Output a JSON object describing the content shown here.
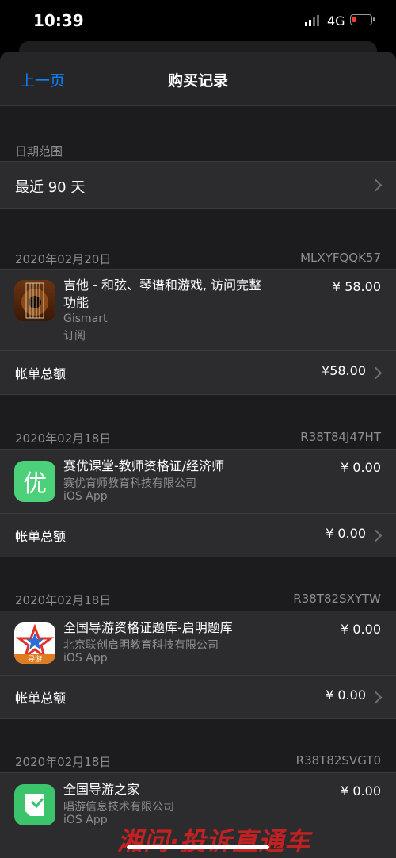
{
  "status": {
    "time": "10:39",
    "network": "4G"
  },
  "nav": {
    "back_label": "上一页",
    "title": "购买记录"
  },
  "date_range": {
    "section_label": "日期范围",
    "value": "最近 90 天"
  },
  "orders": [
    {
      "date": "2020年02月20日",
      "order_id": "MLXYFQQK57",
      "item": {
        "name": "吉他 - 和弦、琴谱和游戏, 访问完整功能",
        "developer": "Gismart",
        "type": "订阅",
        "price": "¥ 58.00",
        "icon": "guitar-app-icon"
      },
      "total_label": "帐单总额",
      "total": "¥58.00"
    },
    {
      "date": "2020年02月18日",
      "order_id": "R38T84J47HT",
      "item": {
        "name": "赛优课堂-教师资格证/经济师",
        "developer": "赛优育师教育科技有限公司",
        "type": "iOS App",
        "price": "¥ 0.00",
        "icon": "saiyou-app-icon",
        "icon_text": "优"
      },
      "total_label": "帐单总额",
      "total": "¥ 0.00"
    },
    {
      "date": "2020年02月18日",
      "order_id": "R38T82SXYTW",
      "item": {
        "name": "全国导游资格证题库-启明题库",
        "developer": "北京联创启明教育科技有限公司",
        "type": "iOS App",
        "price": "¥ 0.00",
        "icon": "daoyou-app-icon",
        "icon_text": "导游"
      },
      "total_label": "帐单总额",
      "total": "¥ 0.00"
    },
    {
      "date": "2020年02月18日",
      "order_id": "R38T82SVGT0",
      "item": {
        "name": "全国导游之家",
        "developer": "唱游信息技术有限公司",
        "type": "iOS App",
        "price": "¥ 0.00",
        "icon": "daoyou-home-app-icon"
      }
    }
  ],
  "watermark": "湘问·投诉直通车",
  "colors": {
    "accent": "#0a84ff",
    "background": "#1c1c1e",
    "card": "#2c2c2e"
  }
}
